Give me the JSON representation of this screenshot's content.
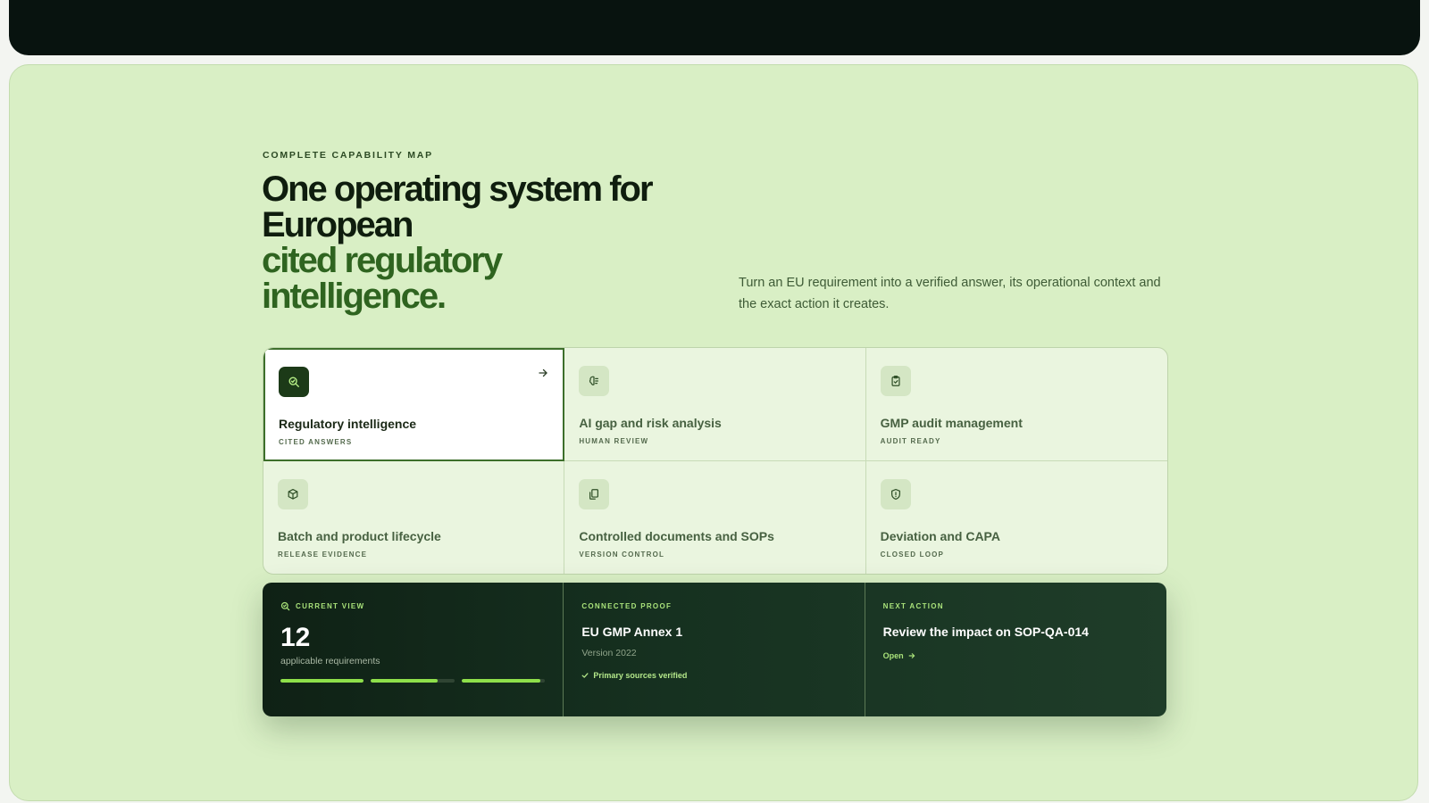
{
  "section": {
    "eyebrow": "COMPLETE CAPABILITY MAP",
    "headline_line1": "One operating system for European",
    "headline_accent": "cited regulatory intelligence.",
    "intro": "Turn an EU requirement into a verified answer, its operational context and the exact action it creates."
  },
  "capabilities": [
    {
      "title": "Regulatory intelligence",
      "subtitle": "CITED ANSWERS",
      "icon": "search-icon",
      "active": true
    },
    {
      "title": "AI gap and risk analysis",
      "subtitle": "HUMAN REVIEW",
      "icon": "brain-icon",
      "active": false
    },
    {
      "title": "GMP audit management",
      "subtitle": "AUDIT READY",
      "icon": "clipboard-check-icon",
      "active": false
    },
    {
      "title": "Batch and product lifecycle",
      "subtitle": "RELEASE EVIDENCE",
      "icon": "package-icon",
      "active": false
    },
    {
      "title": "Controlled documents and SOPs",
      "subtitle": "VERSION CONTROL",
      "icon": "documents-icon",
      "active": false
    },
    {
      "title": "Deviation and CAPA",
      "subtitle": "CLOSED LOOP",
      "icon": "shield-alert-icon",
      "active": false
    }
  ],
  "summary": {
    "current_view": {
      "eyebrow": "CURRENT VIEW",
      "count": "12",
      "label": "applicable requirements",
      "progress": [
        1.0,
        0.8,
        0.95
      ]
    },
    "connected_proof": {
      "eyebrow": "CONNECTED PROOF",
      "title": "EU GMP Annex 1",
      "version": "Version 2022",
      "status": "Primary sources verified"
    },
    "next_action": {
      "eyebrow": "NEXT ACTION",
      "title": "Review the impact on SOP-QA-014",
      "link": "Open"
    }
  },
  "colors": {
    "panel_bg": "#d9efc5",
    "accent_green": "#2f6420",
    "progress_fill": "#8ee04a",
    "dark_bg": "#0f2115"
  }
}
